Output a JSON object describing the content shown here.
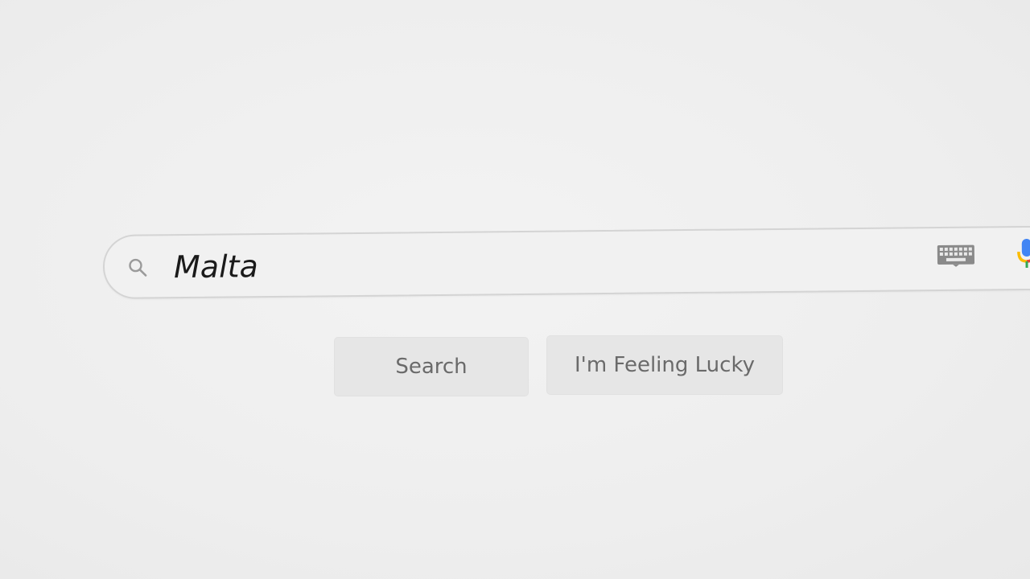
{
  "search": {
    "query": "Malta",
    "icon": "search-icon"
  },
  "tools": {
    "keyboard_icon": "keyboard-icon",
    "mic_icon": "microphone-icon"
  },
  "buttons": {
    "search_label": "Search",
    "lucky_label": "I'm Feeling Lucky"
  },
  "colors": {
    "background": "#efefef",
    "button_bg": "#e6e6e6",
    "button_text": "#6a6a6a",
    "query_text": "#1a1a1a",
    "mic_blue": "#4285f4",
    "mic_red": "#ea4335",
    "mic_yellow": "#fbbc05"
  }
}
